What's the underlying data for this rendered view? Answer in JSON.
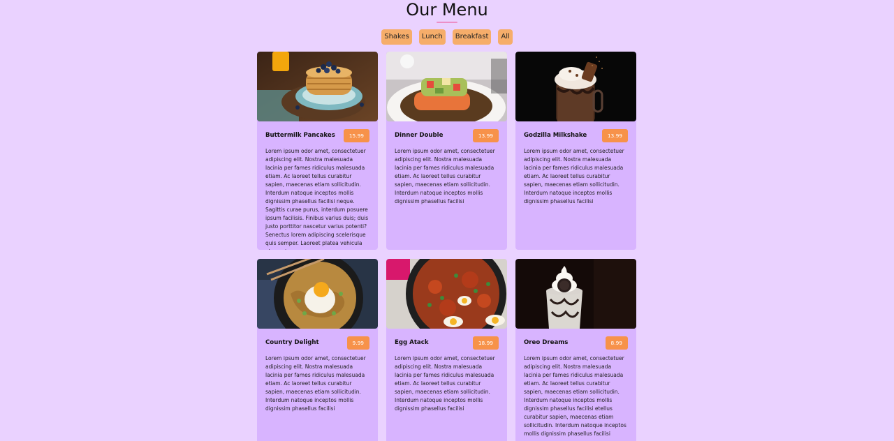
{
  "header": {
    "title": "Our Menu"
  },
  "filters": [
    {
      "label": "Shakes"
    },
    {
      "label": "Lunch"
    },
    {
      "label": "Breakfast"
    },
    {
      "label": "All"
    }
  ],
  "colors": {
    "background": "#ead2ff",
    "card": "#d8b4ff",
    "filter": "#f6ad6a",
    "price": "#f7924a",
    "underline": "#ec8fc7"
  },
  "items": [
    {
      "name": "Buttermilk Pancakes",
      "price": "15.99",
      "image_icon": "pancakes-photo",
      "desc": "Lorem ipsum odor amet, consectetuer adipiscing elit. Nostra malesuada lacinia per fames ridiculus malesuada etiam. Ac laoreet tellus curabitur sapien, maecenas etiam sollicitudin. Interdum natoque inceptos mollis dignissim phasellus facilisi neque. Sagittis curae purus, interdum posuere ipsum facilisis. Finibus varius duis; duis justo porttitor nascetur varius potenti? Senectus lorem adipiscing scelerisque quis semper. Laoreet platea vehicula elementum"
    },
    {
      "name": "Dinner Double",
      "price": "13.99",
      "image_icon": "salmon-dish-photo",
      "desc": "Lorem ipsum odor amet, consectetuer adipiscing elit. Nostra malesuada lacinia per fames ridiculus malesuada etiam. Ac laoreet tellus curabitur sapien, maecenas etiam sollicitudin. Interdum natoque inceptos mollis dignissim phasellus facilisi"
    },
    {
      "name": "Godzilla Milkshake",
      "price": "13.99",
      "image_icon": "milkshake-photo",
      "desc": "Lorem ipsum odor amet, consectetuer adipiscing elit. Nostra malesuada lacinia per fames ridiculus malesuada etiam. Ac laoreet tellus curabitur sapien, maecenas etiam sollicitudin. Interdum natoque inceptos mollis dignissim phasellus facilisi"
    },
    {
      "name": "Country Delight",
      "price": "9.99",
      "image_icon": "noodles-egg-photo",
      "desc": "Lorem ipsum odor amet, consectetuer adipiscing elit. Nostra malesuada lacinia per fames ridiculus malesuada etiam. Ac laoreet tellus curabitur sapien, maecenas etiam sollicitudin. Interdum natoque inceptos mollis dignissim phasellus facilisi"
    },
    {
      "name": "Egg Atack",
      "price": "18.99",
      "image_icon": "shakshuka-photo",
      "desc": "Lorem ipsum odor amet, consectetuer adipiscing elit. Nostra malesuada lacinia per fames ridiculus malesuada etiam. Ac laoreet tellus curabitur sapien, maecenas etiam sollicitudin. Interdum natoque inceptos mollis dignissim phasellus facilisi"
    },
    {
      "name": "Oreo Dreams",
      "price": "8.99",
      "image_icon": "oreo-shake-photo",
      "desc": "Lorem ipsum odor amet, consectetuer adipiscing elit. Nostra malesuada lacinia per fames ridiculus malesuada etiam. Ac laoreet tellus curabitur sapien, maecenas etiam sollicitudin. Interdum natoque inceptos mollis dignissim phasellus facilisi etellus curabitur sapien, maecenas etiam sollicitudin. Interdum natoque inceptos mollis dignissim phasellus facilisi"
    }
  ]
}
